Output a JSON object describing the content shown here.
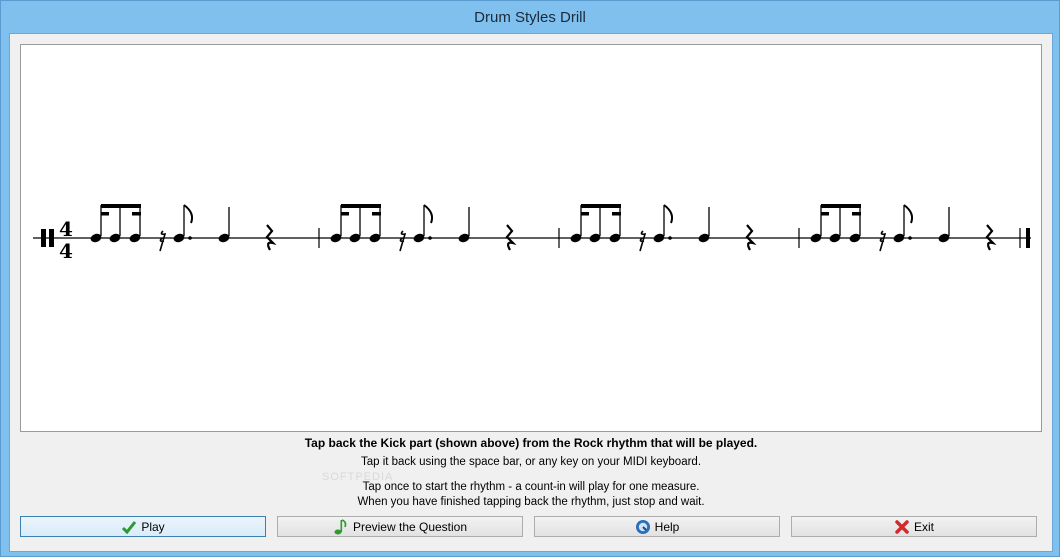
{
  "window": {
    "title": "Drum Styles Drill"
  },
  "instructions": {
    "line1": "Tap back the Kick part (shown above) from the Rock rhythm that will be played.",
    "line2": "Tap it back using the space bar, or any key on your MIDI keyboard.",
    "line3": "Tap once to start the rhythm - a count-in will play for one measure.",
    "line4": "When you have finished tapping back the rhythm, just stop and wait."
  },
  "watermark": "SOFTPEDIA",
  "notation": {
    "time_signature_top": "4",
    "time_signature_bottom": "4",
    "measures": 4
  },
  "buttons": {
    "play": {
      "label": "Play",
      "icon": "check-icon",
      "color": "#2e9a2e"
    },
    "preview": {
      "label": "Preview the Question",
      "icon": "music-note-icon",
      "color": "#2e9a2e"
    },
    "help": {
      "label": "Help",
      "icon": "help-icon",
      "color": "#2a6fb8"
    },
    "exit": {
      "label": "Exit",
      "icon": "close-icon",
      "color": "#d22a2a"
    }
  }
}
